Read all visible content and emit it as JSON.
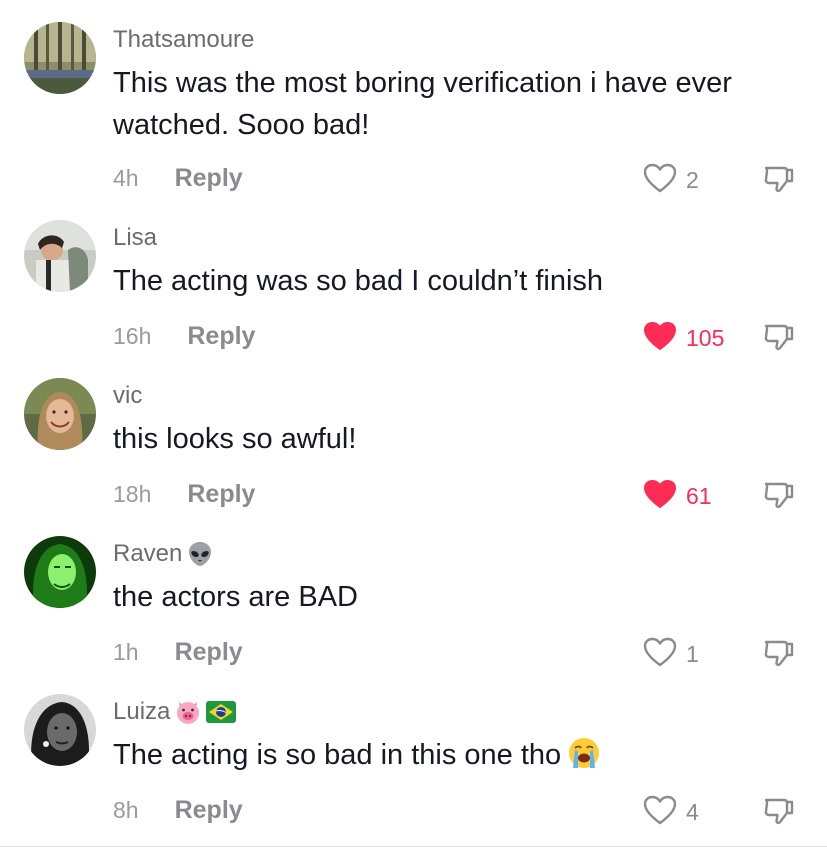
{
  "comments": [
    {
      "author": "Thatsamoure",
      "text": "This was the most boring verification i have ever watched. Sooo bad!",
      "time": "4h",
      "reply_label": "Reply",
      "likes": "2",
      "liked": false
    },
    {
      "author": "Lisa",
      "text": "The acting was so bad I couldn’t finish",
      "time": "16h",
      "reply_label": "Reply",
      "likes": "105",
      "liked": true
    },
    {
      "author": "vic",
      "text": "this looks so awful!",
      "time": "18h",
      "reply_label": "Reply",
      "likes": "61",
      "liked": true
    },
    {
      "author": "Raven",
      "author_emoji": "alien-emoji",
      "text": "the actors are BAD",
      "time": "1h",
      "reply_label": "Reply",
      "likes": "1",
      "liked": false
    },
    {
      "author": "Luiza",
      "author_emoji": [
        "pig-face-emoji",
        "brazil-flag-emoji"
      ],
      "text": "The acting is so bad in this one tho",
      "text_emoji": "loudly-crying-face-emoji",
      "time": "8h",
      "reply_label": "Reply",
      "likes": "4",
      "liked": false
    }
  ],
  "colors": {
    "like_active": "#fe2c55",
    "secondary_text": "#8a8a90",
    "primary_text": "#161823"
  },
  "icons": {
    "like_outline": "heart-outline-icon",
    "like_filled": "heart-filled-icon",
    "dislike": "thumbs-down-icon"
  }
}
